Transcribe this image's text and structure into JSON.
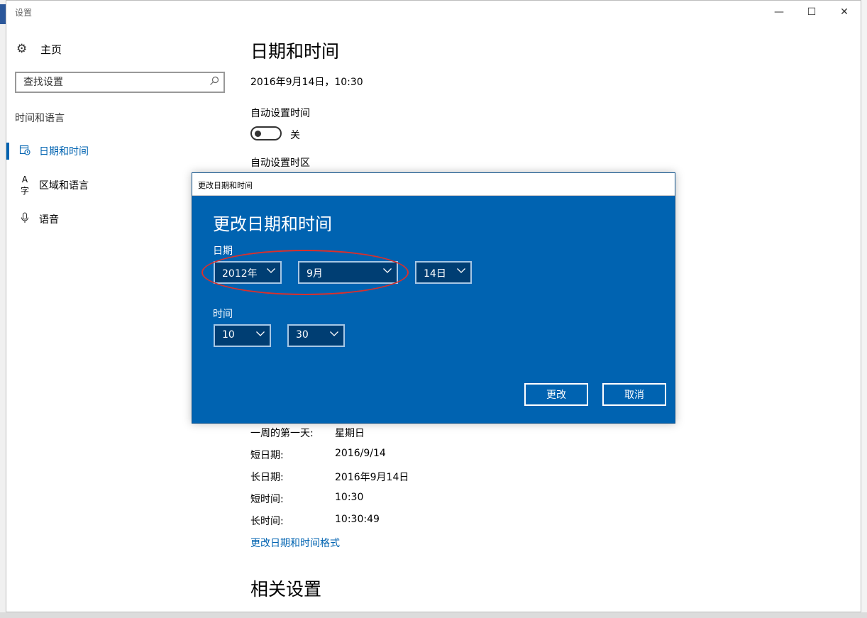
{
  "window": {
    "title": "设置",
    "minimize": "—",
    "maximize": "☐",
    "close": "✕"
  },
  "sidebar": {
    "home_label": "主页",
    "search_placeholder": "查找设置",
    "section_label": "时间和语言",
    "items": [
      {
        "label": "日期和时间",
        "icon": "calendar-clock-icon",
        "active": true
      },
      {
        "label": "区域和语言",
        "icon": "language-icon",
        "active": false
      },
      {
        "label": "语音",
        "icon": "microphone-icon",
        "active": false
      }
    ]
  },
  "main": {
    "title": "日期和时间",
    "current_datetime": "2016年9月14日，10:30",
    "auto_time_label": "自动设置时间",
    "auto_time_state": "关",
    "auto_timezone_label": "自动设置时区",
    "formats": [
      {
        "key": "一周的第一天:",
        "value": "星期日"
      },
      {
        "key": "短日期:",
        "value": "2016/9/14"
      },
      {
        "key": "长日期:",
        "value": "2016年9月14日"
      },
      {
        "key": "短时间:",
        "value": "10:30"
      },
      {
        "key": "长时间:",
        "value": "10:30:49"
      }
    ],
    "change_format_link": "更改日期和时间格式",
    "related_title": "相关设置"
  },
  "dialog": {
    "window_title": "更改日期和时间",
    "heading": "更改日期和时间",
    "date_label": "日期",
    "year": "2012年",
    "month": "9月",
    "day": "14日",
    "time_label": "时间",
    "hour": "10",
    "minute": "30",
    "change_button": "更改",
    "cancel_button": "取消"
  },
  "colors": {
    "accent": "#0063b1",
    "dialog_bg": "#0063b1",
    "combo_bg": "#003e73",
    "highlight": "#d9302c"
  }
}
